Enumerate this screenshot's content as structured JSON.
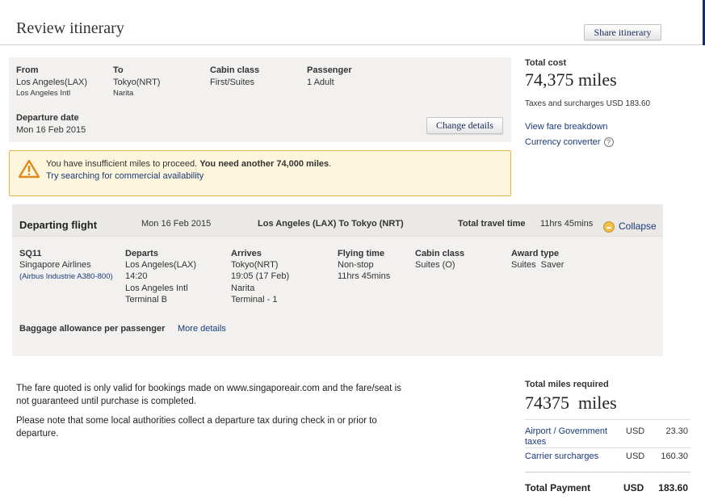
{
  "header": {
    "title": "Review itinerary",
    "share_label": "Share itinerary"
  },
  "search": {
    "from_label": "From",
    "from_value": "Los Angeles(LAX)",
    "from_airport": "Los Angeles Intl",
    "to_label": "To",
    "to_value": "Tokyo(NRT)",
    "to_airport": "Narita",
    "cabin_label": "Cabin class",
    "cabin_value": "First/Suites",
    "passenger_label": "Passenger",
    "passenger_value": "1 Adult",
    "date_label": "Departure date",
    "date_value": "Mon 16 Feb 2015",
    "change_label": "Change details"
  },
  "warning": {
    "text_plain": "You have insufficient miles to proceed. ",
    "text_bold": "You need another 74,000 miles",
    "text_end": ".",
    "link": "Try searching for commercial availability"
  },
  "cost": {
    "label": "Total cost",
    "value": "74,375 miles",
    "taxes": "Taxes and surcharges USD 183.60",
    "fare_link": "View fare breakdown",
    "currency_link": "Currency converter",
    "help_glyph": "?"
  },
  "flight": {
    "title": "Departing flight",
    "date": "Mon 16 Feb 2015",
    "route": "Los Angeles (LAX) To Tokyo (NRT)",
    "travel_label": "Total travel time",
    "travel_value": "11hrs 45mins",
    "collapse_label": "Collapse",
    "number": "SQ11",
    "airline": "Singapore Airlines",
    "aircraft": "(Airbus Industrie A380-800)",
    "departs_label": "Departs",
    "departs_city": "Los Angeles(LAX)",
    "departs_time": "14:20",
    "departs_airport": "Los Angeles Intl",
    "departs_terminal": "Terminal B",
    "arrives_label": "Arrives",
    "arrives_city": "Tokyo(NRT)",
    "arrives_time": "19:05 (17 Feb)",
    "arrives_airport": "Narita",
    "arrives_terminal": "Terminal - 1",
    "flying_label": "Flying time",
    "flying_stops": "Non-stop",
    "flying_value": "11hrs 45mins",
    "cabin_label": "Cabin class",
    "cabin_value": "Suites (O)",
    "award_label": "Award type",
    "award_value": "Suites  Saver",
    "baggage_label": "Baggage allowance per passenger",
    "more_details": "More details"
  },
  "notes": {
    "note1": "The fare quoted is only valid for bookings made on www.singaporeair.com and the fare/seat is not guaranteed until purchase is completed.",
    "note2": "Please note that some local authorities collect a departure tax during check in or prior to departure."
  },
  "summary": {
    "miles_label": "Total miles required",
    "miles_value": "74375  miles",
    "rows": [
      {
        "label": "Airport / Government taxes",
        "currency": "USD",
        "amount": "23.30"
      },
      {
        "label": "Carrier surcharges",
        "currency": "USD",
        "amount": "160.30"
      }
    ],
    "total_label": "Total Payment",
    "total_currency": "USD",
    "total_amount": "183.60"
  },
  "colors": {
    "accent_navy": "#1d2b6e",
    "link": "#1a3a7a",
    "warning_border": "#e5b445",
    "warning_bg": "#fdf5dc",
    "panel_bg": "#f2f1ef"
  }
}
